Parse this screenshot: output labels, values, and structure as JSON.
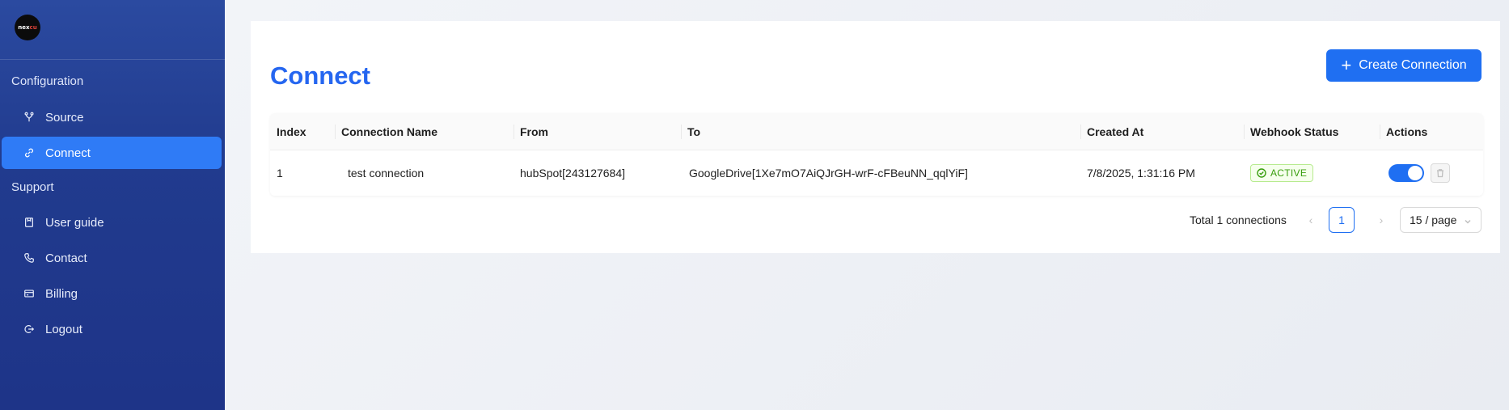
{
  "sidebar": {
    "logo_text": "nex",
    "logo_accent": "cu",
    "sections": [
      {
        "label": "Configuration"
      },
      {
        "label": "Support"
      }
    ],
    "items": [
      {
        "label": "Source",
        "icon": "fork-icon"
      },
      {
        "label": "Connect",
        "icon": "link-icon",
        "active": true
      },
      {
        "label": "User guide",
        "icon": "book-icon"
      },
      {
        "label": "Contact",
        "icon": "phone-icon"
      },
      {
        "label": "Billing",
        "icon": "credit-card-icon"
      },
      {
        "label": "Logout",
        "icon": "logout-icon"
      }
    ]
  },
  "main": {
    "title": "Connect",
    "create_button": {
      "icon": "plus-icon",
      "label": "Create Connection"
    },
    "table": {
      "columns": [
        "Index",
        "Connection Name",
        "From",
        "To",
        "Created At",
        "Webhook Status",
        "Actions"
      ],
      "rows": [
        {
          "index": "1",
          "name": "test connection",
          "from": "hubSpot[243127684]",
          "to": "GoogleDrive[1Xe7mO7AiQJrGH-wrF-cFBeuNN_qqlYiF]",
          "created_at": "7/8/2025, 1:31:16 PM",
          "status": "ACTIVE",
          "enabled": true
        }
      ]
    },
    "pagination": {
      "total_text": "Total 1 connections",
      "current_page": "1",
      "page_size": "15 / page",
      "prev": "‹",
      "next": "›"
    }
  },
  "colors": {
    "accent": "#1f6ff2",
    "title": "#2566f0",
    "sidebar": "#213b8e",
    "active_item": "#2f7bf6",
    "status_green": "#389e0d"
  }
}
